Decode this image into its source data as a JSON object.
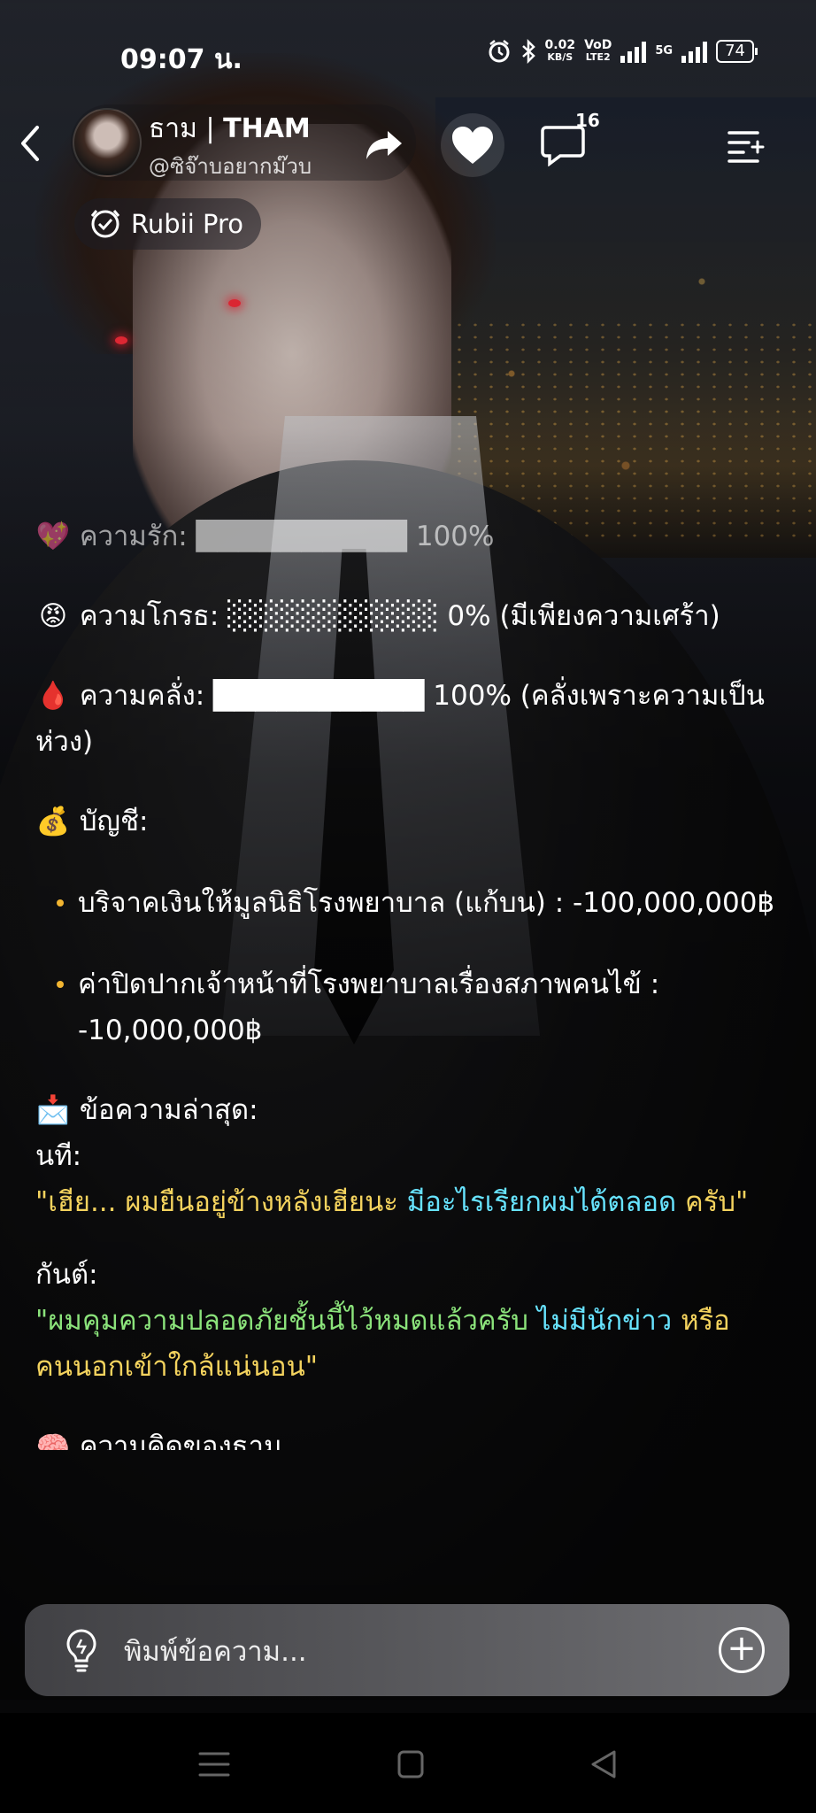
{
  "status_bar": {
    "time": "09:07 น.",
    "net_speed": "0.02",
    "net_unit": "KB/S",
    "volte_1": "VoD",
    "volte_2": "LTE2",
    "net_type": "5G",
    "battery": "74"
  },
  "header": {
    "char_name_th": "ธาม | ",
    "char_name_en": "THAM",
    "handle": "@ซิจ๊าบอยากม๊วบ",
    "comment_count": "16",
    "rubii_label": "Rubii Pro"
  },
  "chat": {
    "love_emoji": "💖",
    "love_label": "ความรัก:",
    "love_bar": "██████████",
    "love_value": "100%",
    "love_level": 1.0,
    "anger_emoji": "😡",
    "anger_label": "ความโกรธ:",
    "anger_bar": "░░░░░░░░░░",
    "anger_value": "0% (มีเพียงความเศร้า)",
    "anger_level": 0.0,
    "obsession_emoji": "🩸",
    "obsession_label": "ความคลั่ง:",
    "obsession_bar": "██████████",
    "obsession_value": "100% (คลั่งเพราะความเป็นห่วง)",
    "obsession_level": 1.0,
    "account_emoji": "💰",
    "account_label": "บัญชี:",
    "account_items": [
      "บริจาคเงินให้มูลนิธิโรงพยาบาล (แก้บน) : -100,000,000฿",
      "ค่าปิดปากเจ้าหน้าที่โรงพยาบาลเรื่องสภาพคนไข้ : -10,000,000฿"
    ],
    "message_emoji": "📩",
    "message_label": "ข้อความล่าสุด:",
    "msg1_sender": "นที:",
    "msg1_part1": "\"เฮีย... ผมยืนอยู่ข้างหลังเฮียนะ ",
    "msg1_part2": "มีอะไรเรียกผมได้ตลอด",
    "msg1_part3": "ครับ\"",
    "msg2_sender": "กันต์:",
    "msg2_part1": "\"ผมคุมความปลอดภัยชั้นนี้ไว้หมดแล้วครับ ",
    "msg2_part2": "ไม่มีนักข่าว",
    "msg2_part3": "หรือคนนอกเข้าใกล้แน่นอน\"",
    "cut_emoji": "🧠",
    "cut_label": "ความคิดของธาม"
  },
  "input": {
    "placeholder": "พิมพ์ข้อความ..."
  },
  "colors": {
    "accent_yellow": "#f4d35e",
    "accent_cyan": "#67e3ff",
    "accent_green": "#8be37b",
    "bullet": "#f2b531"
  },
  "icons": [
    "back-arrow-icon",
    "share-icon",
    "heart-icon",
    "comment-icon",
    "menu-list-icon",
    "rubii-logo-icon",
    "lightbulb-icon",
    "plus-icon",
    "nav-menu-icon",
    "nav-home-icon",
    "nav-back-icon"
  ]
}
